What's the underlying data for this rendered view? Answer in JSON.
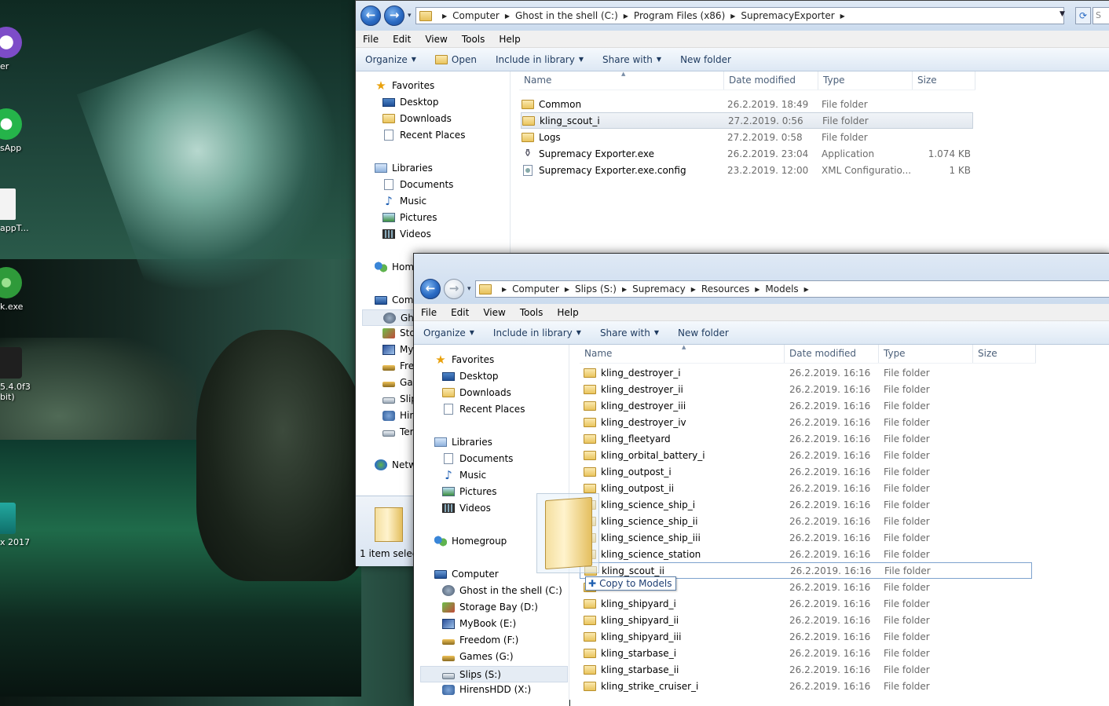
{
  "desktop": {
    "icons": [
      {
        "label": "er"
      },
      {
        "label": "sApp"
      },
      {
        "label": "appT..."
      },
      {
        "label": "k.exe"
      },
      {
        "label": "5.4.0f3"
      },
      {
        "label": "bit)"
      },
      {
        "label": "x 2017"
      }
    ]
  },
  "win1": {
    "breadcrumb": [
      "Computer",
      "Ghost in the shell (C:)",
      "Program Files (x86)",
      "SupremacyExporter"
    ],
    "menu": [
      "File",
      "Edit",
      "View",
      "Tools",
      "Help"
    ],
    "toolbar": {
      "organize": "Organize",
      "open": "Open",
      "include": "Include in library",
      "share": "Share with",
      "newfolder": "New folder"
    },
    "nav": {
      "favorites": "Favorites",
      "desktop": "Desktop",
      "downloads": "Downloads",
      "recent": "Recent Places",
      "libraries": "Libraries",
      "documents": "Documents",
      "music": "Music",
      "pictures": "Pictures",
      "videos": "Videos",
      "homegroup": "Hom",
      "computer": "Com",
      "ghost": "Gho",
      "storage": "Sto",
      "mybook": "My",
      "freedom": "Fre",
      "games": "Gar",
      "slips": "Slip",
      "hirens": "Hir",
      "temp": "Ter",
      "network": "Netw"
    },
    "columns": {
      "name": "Name",
      "date": "Date modified",
      "type": "Type",
      "size": "Size"
    },
    "files": [
      {
        "name": "Common",
        "date": "26.2.2019. 18:49",
        "type": "File folder",
        "size": "",
        "icon": "folder"
      },
      {
        "name": "kling_scout_i",
        "date": "27.2.2019. 0:56",
        "type": "File folder",
        "size": "",
        "icon": "folder"
      },
      {
        "name": "Logs",
        "date": "27.2.2019. 0:58",
        "type": "File folder",
        "size": "",
        "icon": "folder"
      },
      {
        "name": "Supremacy Exporter.exe",
        "date": "26.2.2019. 23:04",
        "type": "Application",
        "size": "1.074 KB",
        "icon": "exe"
      },
      {
        "name": "Supremacy Exporter.exe.config",
        "date": "23.2.2019. 12:00",
        "type": "XML Configuratio...",
        "size": "1 KB",
        "icon": "cfg"
      }
    ],
    "status": "1 item select"
  },
  "win2": {
    "breadcrumb": [
      "Computer",
      "Slips (S:)",
      "Supremacy",
      "Resources",
      "Models"
    ],
    "menu": [
      "File",
      "Edit",
      "View",
      "Tools",
      "Help"
    ],
    "toolbar": {
      "organize": "Organize",
      "include": "Include in library",
      "share": "Share with",
      "newfolder": "New folder"
    },
    "nav": {
      "favorites": "Favorites",
      "desktop": "Desktop",
      "downloads": "Downloads",
      "recent": "Recent Places",
      "libraries": "Libraries",
      "documents": "Documents",
      "music": "Music",
      "pictures": "Pictures",
      "videos": "Videos",
      "homegroup": "Homegroup",
      "computer": "Computer",
      "ghost": "Ghost in the shell (C:)",
      "storage": "Storage Bay (D:)",
      "mybook": "MyBook (E:)",
      "freedom": "Freedom (F:)",
      "games": "Games (G:)",
      "slips": "Slips (S:)",
      "hirens": "HirensHDD (X:)"
    },
    "columns": {
      "name": "Name",
      "date": "Date modified",
      "type": "Type",
      "size": "Size"
    },
    "files": [
      {
        "name": "kling_destroyer_i",
        "date": "26.2.2019. 16:16",
        "type": "File folder"
      },
      {
        "name": "kling_destroyer_ii",
        "date": "26.2.2019. 16:16",
        "type": "File folder"
      },
      {
        "name": "kling_destroyer_iii",
        "date": "26.2.2019. 16:16",
        "type": "File folder"
      },
      {
        "name": "kling_destroyer_iv",
        "date": "26.2.2019. 16:16",
        "type": "File folder"
      },
      {
        "name": "kling_fleetyard",
        "date": "26.2.2019. 16:16",
        "type": "File folder"
      },
      {
        "name": "kling_orbital_battery_i",
        "date": "26.2.2019. 16:16",
        "type": "File folder"
      },
      {
        "name": "kling_outpost_i",
        "date": "26.2.2019. 16:16",
        "type": "File folder"
      },
      {
        "name": "kling_outpost_ii",
        "date": "26.2.2019. 16:16",
        "type": "File folder"
      },
      {
        "name": "kling_science_ship_i",
        "date": "26.2.2019. 16:16",
        "type": "File folder"
      },
      {
        "name": "kling_science_ship_ii",
        "date": "26.2.2019. 16:16",
        "type": "File folder"
      },
      {
        "name": "kling_science_ship_iii",
        "date": "26.2.2019. 16:16",
        "type": "File folder"
      },
      {
        "name": "kling_science_station",
        "date": "26.2.2019. 16:16",
        "type": "File folder"
      },
      {
        "name": "kling_scout_ii",
        "date": "26.2.2019. 16:16",
        "type": "File folder"
      },
      {
        "name": "",
        "date": "26.2.2019. 16:16",
        "type": "File folder"
      },
      {
        "name": "kling_shipyard_i",
        "date": "26.2.2019. 16:16",
        "type": "File folder"
      },
      {
        "name": "kling_shipyard_ii",
        "date": "26.2.2019. 16:16",
        "type": "File folder"
      },
      {
        "name": "kling_shipyard_iii",
        "date": "26.2.2019. 16:16",
        "type": "File folder"
      },
      {
        "name": "kling_starbase_i",
        "date": "26.2.2019. 16:16",
        "type": "File folder"
      },
      {
        "name": "kling_starbase_ii",
        "date": "26.2.2019. 16:16",
        "type": "File folder"
      },
      {
        "name": "kling_strike_cruiser_i",
        "date": "26.2.2019. 16:16",
        "type": "File folder"
      }
    ],
    "drag_tooltip": "Copy to Models"
  }
}
